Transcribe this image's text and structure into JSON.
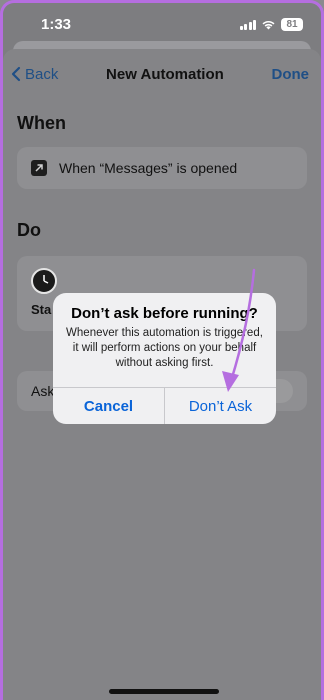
{
  "status_bar": {
    "time": "1:33",
    "battery": "81"
  },
  "nav": {
    "back_label": "Back",
    "title": "New Automation",
    "done_label": "Done"
  },
  "when": {
    "section_title": "When",
    "trigger_text": "When “Messages” is opened",
    "trigger_icon": "arrow-up-right-icon"
  },
  "do": {
    "section_title": "Do",
    "action_label": "Sta",
    "action_icon": "clock-icon"
  },
  "ask_row": {
    "label": "Ask"
  },
  "alert": {
    "title": "Don’t ask before running?",
    "message": "Whenever this automation is triggered, it will perform actions on your behalf without asking first.",
    "cancel_label": "Cancel",
    "confirm_label": "Don’t Ask"
  },
  "colors": {
    "accent": "#0a64d8",
    "annotation_arrow": "#b56ee0"
  }
}
